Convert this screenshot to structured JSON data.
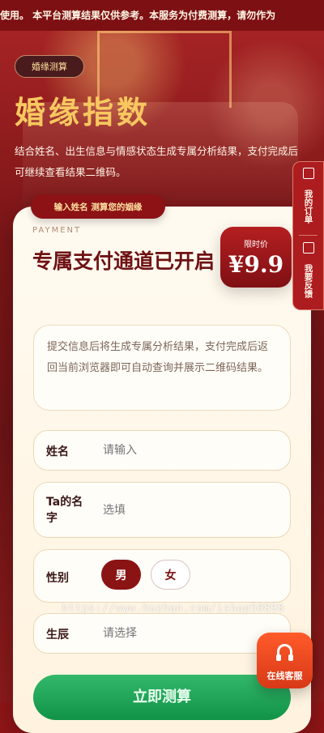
{
  "marquee": {
    "text": "使用。    本平台测算结果仅供参考。本服务为付费测算，请勿作为"
  },
  "top_tag": "婚缘测算",
  "title": "婚缘指数",
  "subtitle": "结合姓名、出生信息与情感状态生成专属分析结果，支付完成后可继续查看结果二维码。",
  "card_pill": "输入姓名 测算您的姻缘",
  "payment_label": "PAYMENT",
  "payment_title": "专属支付通道已开启",
  "price": {
    "label": "限时价",
    "value": "¥9.9"
  },
  "notice": "提交信息后将生成专属分析结果，支付完成后返回当前浏览器即可自动查询并展示二维码结果。",
  "fields": {
    "name": {
      "label": "姓名",
      "placeholder": "请输入"
    },
    "partner_name": {
      "label": "Ta的名字",
      "placeholder": "选填"
    },
    "gender": {
      "label": "性别",
      "options": [
        "男",
        "女"
      ],
      "selected": "男"
    },
    "birth": {
      "label": "生辰",
      "placeholder": "请选择"
    }
  },
  "submit_label": "立即测算",
  "side_tabs": {
    "orders": "我的订单",
    "feedback": "我要反馈"
  },
  "service": {
    "label": "在线客服"
  },
  "watermark": "https://www.huzhan.com/ishop50898",
  "colors": {
    "primary": "#8a1314",
    "accent": "#f8c860",
    "submit": "#1ea85a",
    "service": "#ff5a2a"
  },
  "icons": [
    "order-icon",
    "feedback-icon",
    "headset-icon"
  ]
}
